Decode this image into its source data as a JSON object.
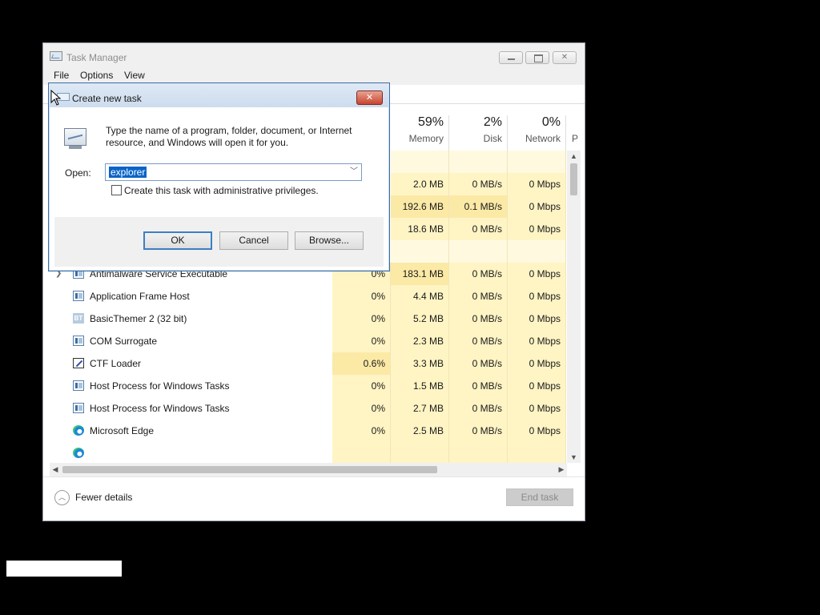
{
  "task_manager": {
    "title": "Task Manager",
    "menu": [
      "File",
      "Options",
      "View"
    ],
    "columns": [
      {
        "pct": "59%",
        "name": "Memory"
      },
      {
        "pct": "2%",
        "name": "Disk"
      },
      {
        "pct": "0%",
        "name": "Network"
      },
      {
        "pct": "",
        "name": "P"
      }
    ],
    "upper_rows": [
      {
        "memory": "2.0 MB",
        "disk": "0 MB/s",
        "network": "0 Mbps"
      },
      {
        "memory": "192.6 MB",
        "disk": "0.1 MB/s",
        "network": "0 Mbps"
      },
      {
        "memory": "18.6 MB",
        "disk": "0 MB/s",
        "network": "0 Mbps"
      }
    ],
    "processes": [
      {
        "name": "Antimalware Service Executable",
        "icon": "frame-icon",
        "expandable": true,
        "cpu": "0%",
        "memory": "183.1 MB",
        "disk": "0 MB/s",
        "network": "0 Mbps"
      },
      {
        "name": "Application Frame Host",
        "icon": "frame-icon",
        "cpu": "0%",
        "memory": "4.4 MB",
        "disk": "0 MB/s",
        "network": "0 Mbps"
      },
      {
        "name": "BasicThemer 2 (32 bit)",
        "icon": "basicthemer-icon",
        "cpu": "0%",
        "memory": "5.2 MB",
        "disk": "0 MB/s",
        "network": "0 Mbps"
      },
      {
        "name": "COM Surrogate",
        "icon": "frame-icon",
        "cpu": "0%",
        "memory": "2.3 MB",
        "disk": "0 MB/s",
        "network": "0 Mbps"
      },
      {
        "name": "CTF Loader",
        "icon": "ctf-icon",
        "cpu": "0.6%",
        "memory": "3.3 MB",
        "disk": "0 MB/s",
        "network": "0 Mbps"
      },
      {
        "name": "Host Process for Windows Tasks",
        "icon": "frame-icon",
        "cpu": "0%",
        "memory": "1.5 MB",
        "disk": "0 MB/s",
        "network": "0 Mbps"
      },
      {
        "name": "Host Process for Windows Tasks",
        "icon": "frame-icon",
        "cpu": "0%",
        "memory": "2.7 MB",
        "disk": "0 MB/s",
        "network": "0 Mbps"
      },
      {
        "name": "Microsoft Edge",
        "icon": "edge-icon",
        "cpu": "0%",
        "memory": "2.5 MB",
        "disk": "0 MB/s",
        "network": "0 Mbps"
      }
    ],
    "footer": {
      "fewer_details": "Fewer details",
      "end_task": "End task"
    }
  },
  "dialog": {
    "title": "Create new task",
    "description": "Type the name of a program, folder, document, or Internet resource, and Windows will open it for you.",
    "open_label": "Open:",
    "open_value": "explorer",
    "admin_label": "Create this task with administrative privileges.",
    "admin_checked": false,
    "buttons": {
      "ok": "OK",
      "cancel": "Cancel",
      "browse": "Browse..."
    }
  },
  "colors": {
    "heat_light": "#fff4c4",
    "heat_medium": "#fbe9a6",
    "selection": "#0a64c8",
    "close_button": "#c8442f"
  }
}
